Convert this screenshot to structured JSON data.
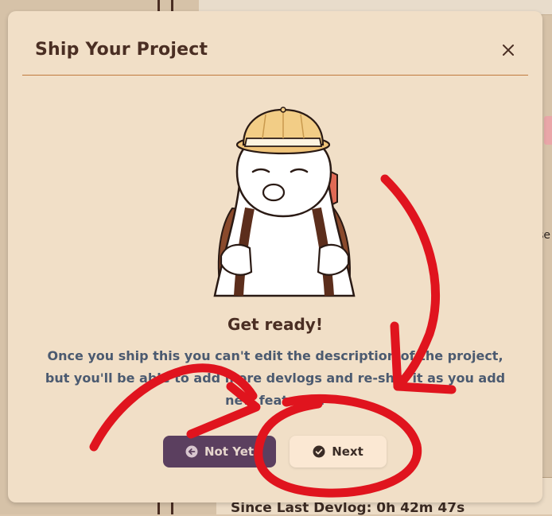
{
  "modal": {
    "title": "Ship Your Project",
    "heading": "Get ready!",
    "description": "Once you ship this you can't edit the description of the project, but you'll be able to add more devlogs and re-ship it as you add new features!",
    "buttons": {
      "not_yet": "Not Yet",
      "next": "Next"
    }
  },
  "background": {
    "footer_text": "Since Last Devlog: 0h 42m 47s",
    "edge_text": "se"
  },
  "icons": {
    "close": "close-icon",
    "not_yet": "arrow-left-circle-icon",
    "next": "check-circle-icon",
    "mascot": "explorer-mascot-illustration"
  },
  "colors": {
    "modal_bg": "#f1dfc7",
    "title_text": "#4a2e23",
    "divider": "#c07a3e",
    "description_text": "#4b5a70",
    "not_yet_bg": "#5b3f5f",
    "next_bg": "#fbe8d3",
    "annotation_red": "#e0141e"
  }
}
